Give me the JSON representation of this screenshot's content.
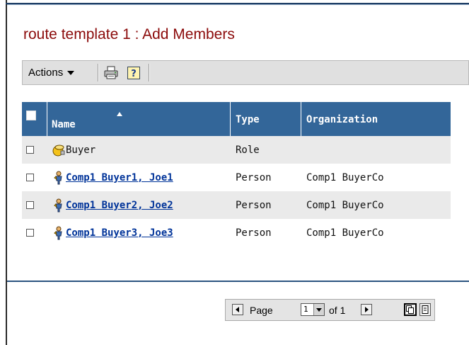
{
  "page": {
    "title": "route template 1 : Add Members"
  },
  "toolbar": {
    "actions_label": "Actions",
    "print_icon": "printer-icon",
    "help_icon": "help-icon"
  },
  "table": {
    "columns": [
      "Name",
      "Type",
      "Organization"
    ],
    "sort_column": "Name",
    "sort_direction": "ascending",
    "rows": [
      {
        "name": "Buyer",
        "type": "Role",
        "organization": "",
        "icon": "role-icon",
        "is_link": false
      },
      {
        "name": "Comp1 Buyer1, Joe1",
        "type": "Person",
        "organization": "Comp1 BuyerCo",
        "icon": "person-icon",
        "is_link": true
      },
      {
        "name": "Comp1 Buyer2, Joe2",
        "type": "Person",
        "organization": "Comp1 BuyerCo",
        "icon": "person-icon",
        "is_link": true
      },
      {
        "name": "Comp1 Buyer3, Joe3",
        "type": "Person",
        "organization": "Comp1 BuyerCo",
        "icon": "person-icon",
        "is_link": true
      }
    ]
  },
  "pager": {
    "page_label": "Page",
    "current_page": "1",
    "of_label": "of 1"
  },
  "colors": {
    "title": "#8b0a0a",
    "header_bg": "#336699",
    "link": "#003399"
  }
}
